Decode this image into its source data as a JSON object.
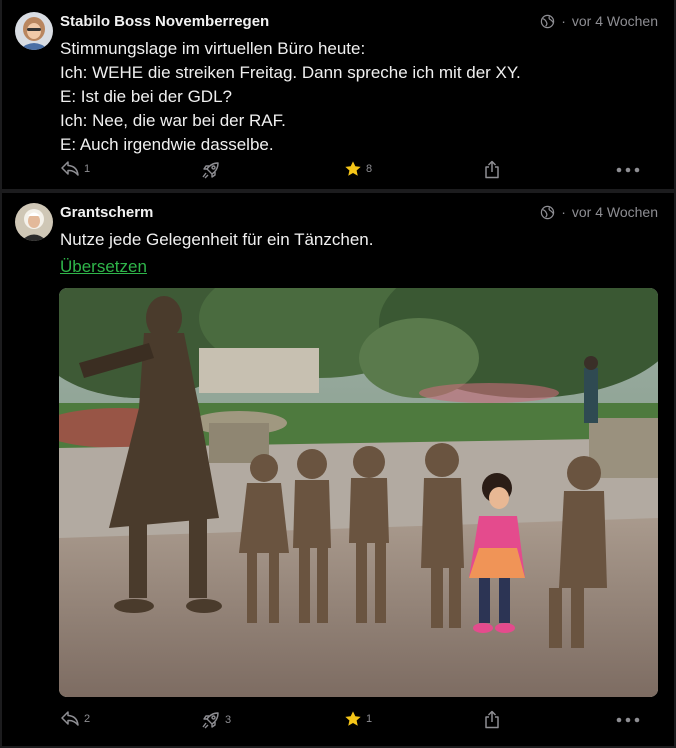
{
  "posts": [
    {
      "author": "Stabilo Boss Novemberregen",
      "time": "vor 4 Wochen",
      "lines": [
        "Stimmungslage im virtuellen Büro heute:",
        "Ich: WEHE die streiken Freitag. Dann spreche ich mit der XY.",
        "E: Ist die bei der GDL?",
        "Ich: Nee, die war bei der RAF.",
        "E: Auch irgendwie dasselbe."
      ],
      "replies": "1",
      "boosts": "",
      "favourites": "8"
    },
    {
      "author": "Grantscherm",
      "time": "vor 4 Wochen",
      "lines": [
        "Nutze jede Gelegenheit für ein Tänzchen."
      ],
      "translate": "Übersetzen",
      "replies": "2",
      "boosts": "3",
      "favourites": "1"
    }
  ],
  "colors": {
    "background": "#1c1c1e",
    "card": "#000000",
    "muted": "#8e8e93",
    "link": "#2fb54a",
    "star": "#f5c518"
  },
  "icons": [
    "globe-icon",
    "reply-icon",
    "boost-icon",
    "star-icon",
    "share-icon",
    "more-icon"
  ]
}
